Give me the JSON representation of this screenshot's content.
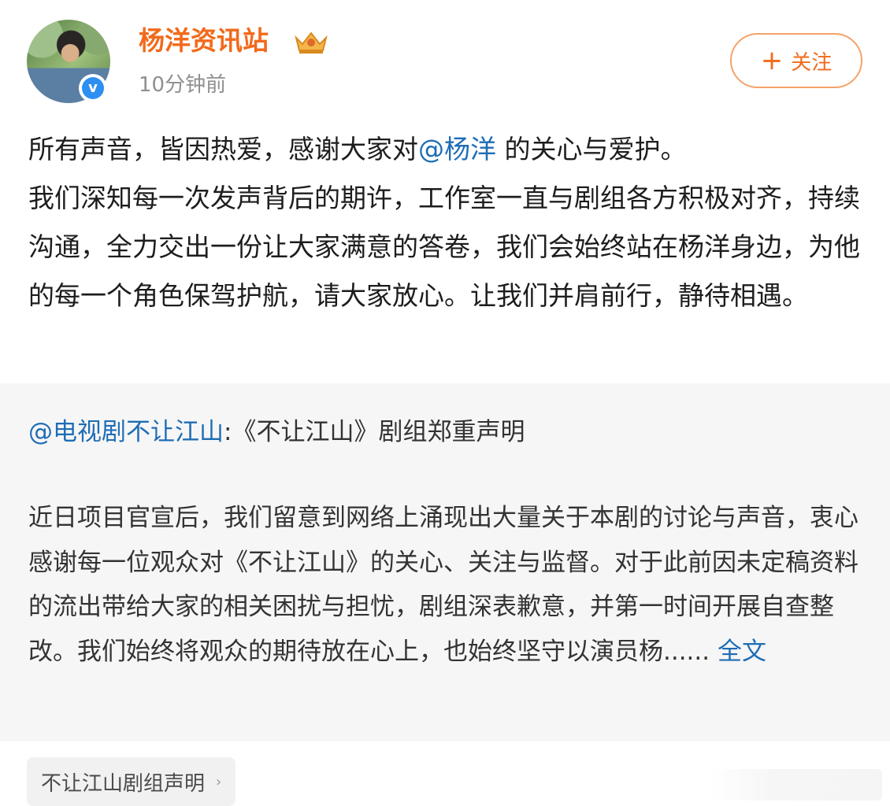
{
  "header": {
    "username": "杨洋资讯站",
    "timestamp": "10分钟前",
    "follow_label": "关注",
    "verified_icon": "verified-badge",
    "vip_icon": "vip-crown"
  },
  "post": {
    "line1_prefix": "所有声音，皆因热爱，感谢大家对",
    "line1_mention": "@杨洋",
    "line1_suffix": " 的关心与爱护。",
    "body": "我们深知每一次发声背后的期许，工作室一直与剧组各方积极对齐，持续沟通，全力交出一份让大家满意的答卷，我们会始终站在杨洋身边，为他的每一个角色保驾护航，请大家放心。让我们并肩前行，静待相遇。"
  },
  "repost": {
    "source": "@电视剧不让江山",
    "title": ":《不让江山》剧组郑重声明",
    "body": "近日项目官宣后，我们留意到网络上涌现出大量关于本剧的讨论与声音，衷心感谢每一位观众对《不让江山》的关心、关注与监督。对于此前因未定稿资料的流出带给大家的相关困扰与担忧，剧组深表歉意，并第一时间开展自查整改。我们始终将观众的期待放在心上，也始终坚守以演员杨......",
    "full_text_label": "全文"
  },
  "topic": {
    "label": "不让江山剧组声明"
  },
  "colors": {
    "username": "#f26a1b",
    "link": "#1e6db5",
    "follow_border": "#f5a26a",
    "repost_bg": "#f6f6f6"
  }
}
